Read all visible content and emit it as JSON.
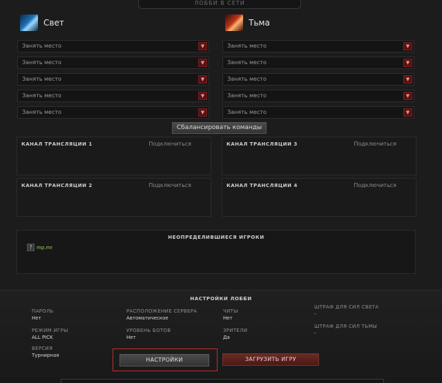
{
  "window": {
    "title": "ЛОББИ В СЕТИ"
  },
  "teams": {
    "radiant": {
      "name": "Свет",
      "slots": [
        "Занять место",
        "Занять место",
        "Занять место",
        "Занять место",
        "Занять место"
      ]
    },
    "dire": {
      "name": "Тьма",
      "slots": [
        "Занять место",
        "Занять место",
        "Занять место",
        "Занять место",
        "Занять место"
      ]
    }
  },
  "balance_button": "Сбалансировать команды",
  "broadcast": {
    "join_label": "Подключиться",
    "channels": [
      "КАНАЛ ТРАНСЛЯЦИИ 1",
      "КАНАЛ ТРАНСЛЯЦИИ 3",
      "КАНАЛ ТРАНСЛЯЦИИ 2",
      "КАНАЛ ТРАНСЛЯЦИИ 4"
    ]
  },
  "unassigned": {
    "title": "НЕОПРЕДЕЛИВШИЕСЯ ИГРОКИ",
    "players": [
      {
        "avatar": "?",
        "name": "mp.mr"
      }
    ]
  },
  "settings": {
    "title": "НАСТРОЙКИ ЛОББИ",
    "password_label": "ПАРОЛЬ",
    "password_value": "Нет",
    "game_mode_label": "РЕЖИМ ИГРЫ",
    "game_mode_value": "ALL PICK",
    "version_label": "ВЕРСИЯ",
    "version_value": "Турнирная",
    "server_label": "РАСПОЛОЖЕНИЕ СЕРВЕРА",
    "server_value": "Автоматическое",
    "bots_label": "УРОВЕНЬ БОТОВ",
    "bots_value": "Нет",
    "cheats_label": "ЧИТЫ",
    "cheats_value": "Нет",
    "spectators_label": "ЗРИТЕЛИ",
    "spectators_value": "Да",
    "radiant_penalty_label": "ШТРАФ ДЛЯ СИЛ СВЕТА",
    "radiant_penalty_value": "-",
    "dire_penalty_label": "ШТРАФ ДЛЯ СИЛ ТЬМЫ",
    "dire_penalty_value": "-"
  },
  "buttons": {
    "settings": "НАСТРОЙКИ",
    "load_game": "ЗАГРУЗИТЬ ИГРУ"
  },
  "icons": {
    "dropdown": "chevron-down-icon",
    "radiant": "radiant-team-icon",
    "dire": "dire-team-icon"
  }
}
